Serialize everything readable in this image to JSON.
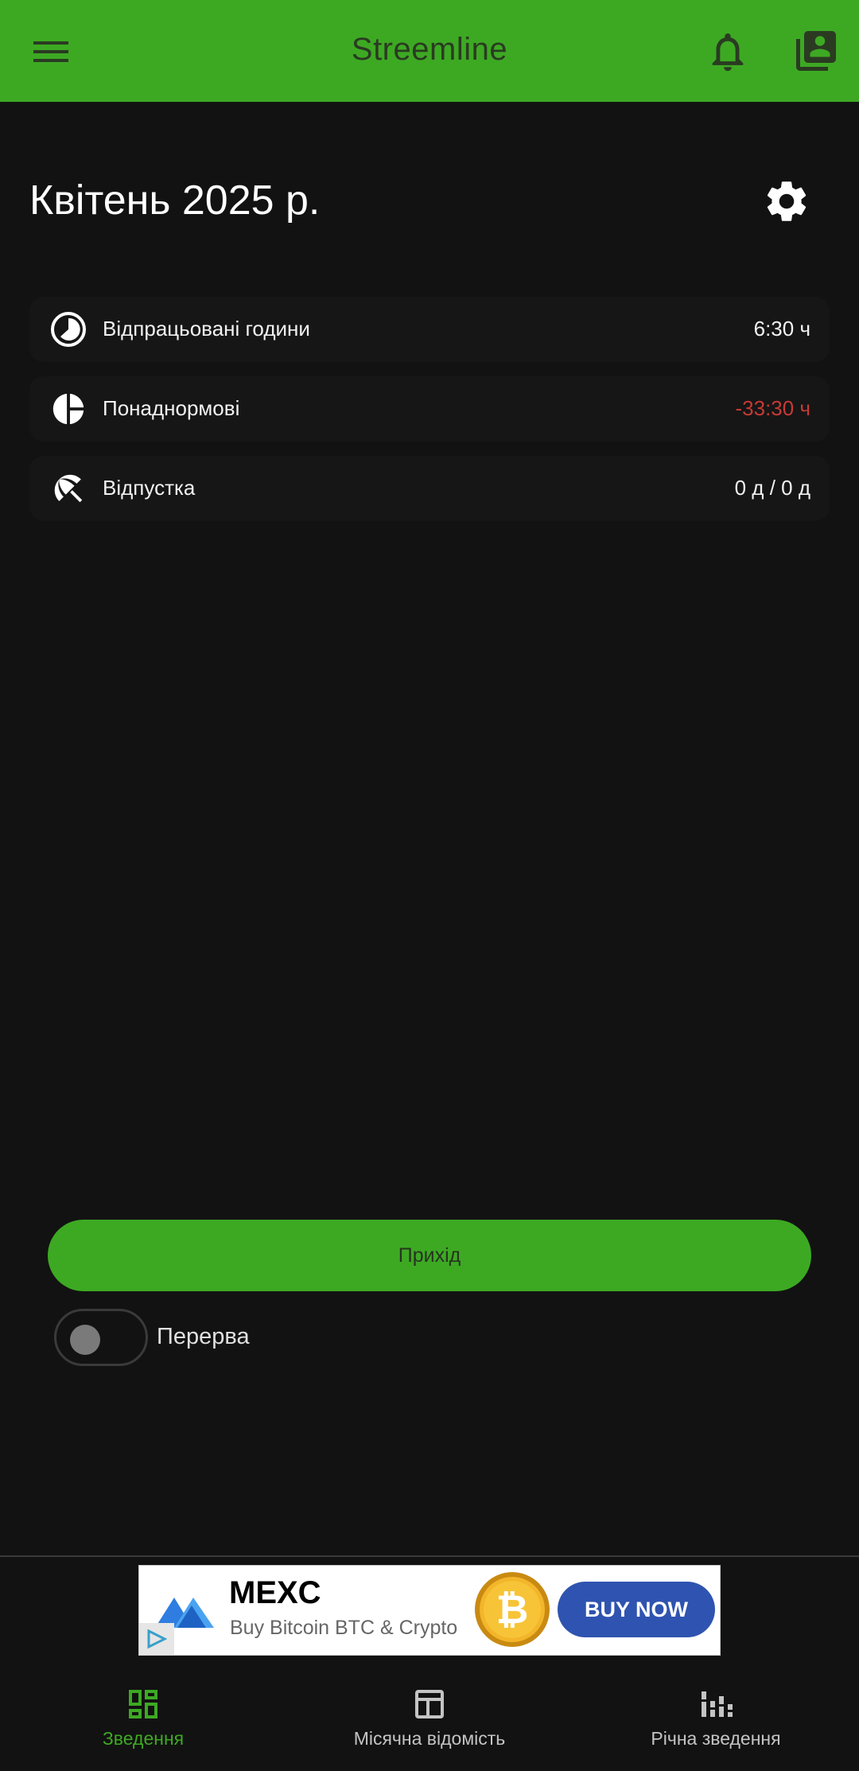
{
  "app_bar": {
    "title": "Streemline",
    "menu_icon": "hamburger-menu-icon",
    "notifications_icon": "bell-icon",
    "profile_icon": "profile-gallery-icon",
    "background": "#3da923"
  },
  "header": {
    "month_title": "Квітень 2025 р.",
    "settings_icon": "gear-icon"
  },
  "stats": [
    {
      "label": "Відпрацьовані години",
      "value": "6:30 ч",
      "icon": "clock-pie-icon"
    },
    {
      "label": "Понаднормові",
      "value": "-33:30 ч",
      "icon": "pie-chart-icon",
      "value_color": "#c73a35"
    },
    {
      "label": "Відпустка",
      "value": "0 д / 0 д",
      "icon": "beach-umbrella-icon"
    }
  ],
  "actions": {
    "arrival_label": "Прихід",
    "break_label": "Перерва",
    "break_on": false
  },
  "ad": {
    "title": "MEXC",
    "subtitle": "Buy Bitcoin BTC & Crypto",
    "cta": "BUY NOW"
  },
  "bottom_nav": [
    {
      "label": "Зведення",
      "icon": "dashboard-icon",
      "active": true
    },
    {
      "label": "Місячна відомість",
      "icon": "table-icon",
      "active": false
    },
    {
      "label": "Річна зведення",
      "icon": "bar-chart-icon",
      "active": false
    }
  ],
  "colors": {
    "accent": "#3da923",
    "background": "#121212",
    "negative": "#c73a35"
  }
}
